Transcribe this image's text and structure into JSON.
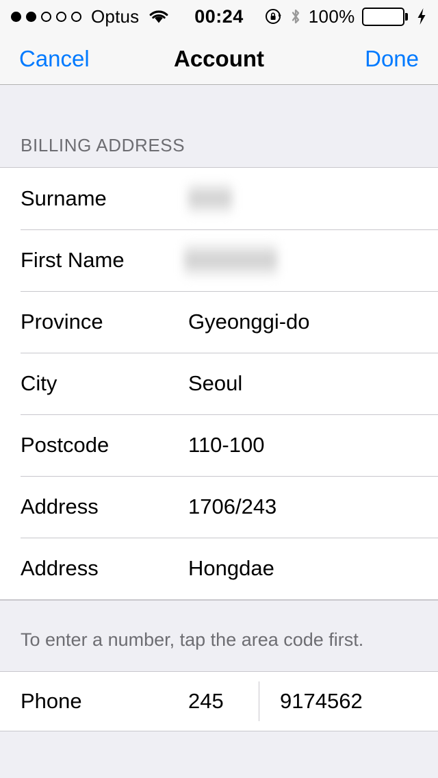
{
  "status_bar": {
    "signal_dots": {
      "filled": 2,
      "total": 5
    },
    "carrier": "Optus",
    "wifi_icon": "wifi-icon",
    "time": "00:24",
    "rotation_lock_icon": "rotation-lock-icon",
    "bluetooth_icon": "bluetooth-icon",
    "battery_percent": "100%",
    "battery_level": 100,
    "battery_color": "#4CD964",
    "charging_icon": "lightning-bolt-icon"
  },
  "nav_bar": {
    "cancel_label": "Cancel",
    "title": "Account",
    "done_label": "Done",
    "tint_color": "#007AFF"
  },
  "billing_section": {
    "header": "BILLING ADDRESS",
    "rows": [
      {
        "label": "Surname",
        "value": "",
        "redacted": true,
        "redaction": "short"
      },
      {
        "label": "First Name",
        "value": "",
        "redacted": true,
        "redaction": "long"
      },
      {
        "label": "Province",
        "value": "Gyeonggi-do",
        "redacted": false
      },
      {
        "label": "City",
        "value": "Seoul",
        "redacted": false
      },
      {
        "label": "Postcode",
        "value": "110-100",
        "redacted": false
      },
      {
        "label": "Address",
        "value": "1706/243",
        "redacted": false
      },
      {
        "label": "Address",
        "value": "Hongdae",
        "redacted": false
      }
    ]
  },
  "phone_section": {
    "footer_note": "To enter a number, tap the area code first.",
    "label": "Phone",
    "area_code": "245",
    "number": "9174562"
  }
}
